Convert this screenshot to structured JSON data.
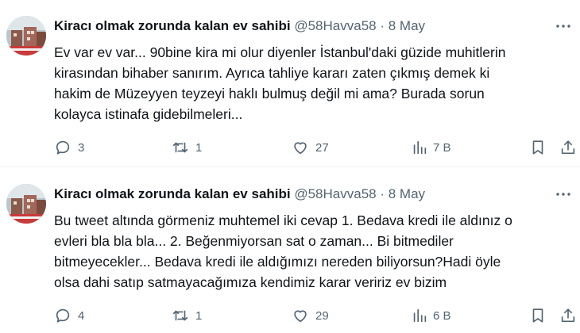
{
  "tweets": [
    {
      "author_name": "Kiracı olmak zorunda kalan ev sahibi",
      "handle": "@58Havva58",
      "separator": "·",
      "date": "8 May",
      "text": "Ev var ev var... 90bine kira mi olur diyenler İstanbul'daki güzide muhitlerin\nkirasından bihaber sanırım. Ayrıca tahliye kararı zaten çıkmış demek ki\nhakim de Müzeyyen teyzeyi haklı bulmuş değil mi ama? Burada sorun\nkolayca istinafa gidebilmeleri...",
      "replies": "3",
      "retweets": "1",
      "likes": "27",
      "views": "7 B",
      "icons": [
        "avatar",
        "more-icon",
        "reply-icon",
        "retweet-icon",
        "like-icon",
        "views-icon",
        "bookmark-icon",
        "share-icon"
      ]
    },
    {
      "author_name": "Kiracı olmak zorunda kalan ev sahibi",
      "handle": "@58Havva58",
      "separator": "·",
      "date": "8 May",
      "text": "Bu tweet altında görmeniz muhtemel iki cevap 1. Bedava kredi ile aldınız o\nevleri bla bla bla... 2. Beğenmiyorsan sat o zaman... Bi bitmediler\nbitmeyecekler... Bedava kredi ile aldığımızı nereden biliyorsun?Hadi öyle\nolsa dahi satıp satmayacağımıza kendimiz karar veririz ev bizim",
      "replies": "4",
      "retweets": "1",
      "likes": "29",
      "views": "6 B",
      "icons": [
        "avatar",
        "more-icon",
        "reply-icon",
        "retweet-icon",
        "like-icon",
        "views-icon",
        "bookmark-icon",
        "share-icon"
      ]
    }
  ],
  "colors": {
    "text_primary": "#0f1419",
    "text_secondary": "#536471",
    "divider": "#eff3f4",
    "background": "#ffffff"
  }
}
